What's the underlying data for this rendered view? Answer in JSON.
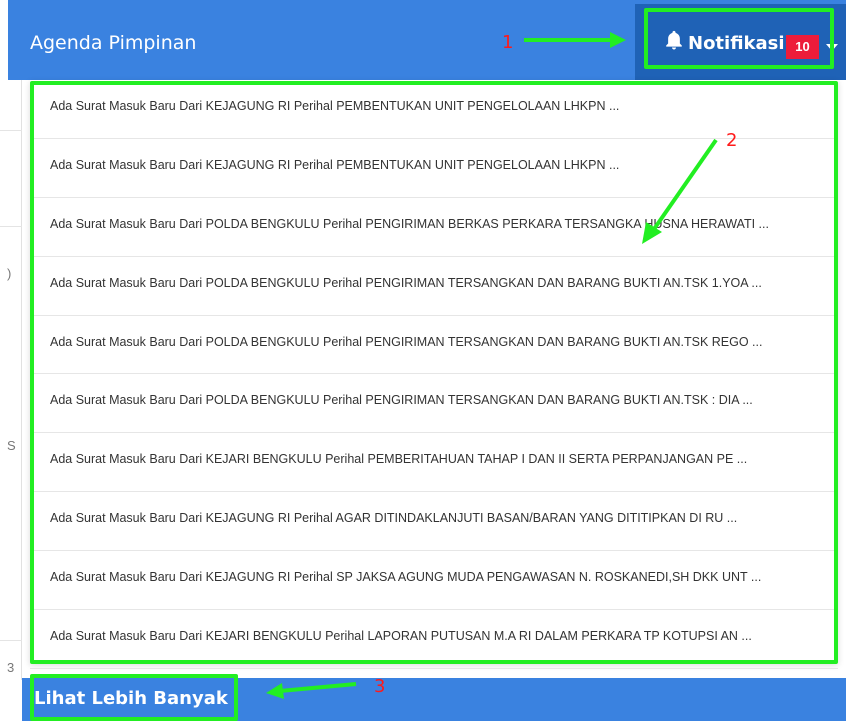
{
  "header": {
    "title": "Agenda Pimpinan",
    "notifications": {
      "icon": "bell-icon",
      "label": "Notifikasi",
      "count": "10",
      "dropdown_icon": "caret-down-icon"
    }
  },
  "notifications": [
    "Ada Surat Masuk Baru Dari KEJAGUNG RI Perihal PEMBENTUKAN UNIT PENGELOLAAN LHKPN ...",
    "Ada Surat Masuk Baru Dari KEJAGUNG RI Perihal PEMBENTUKAN UNIT PENGELOLAAN LHKPN ...",
    "Ada Surat Masuk Baru Dari POLDA BENGKULU Perihal PENGIRIMAN BERKAS PERKARA TERSANGKA HUSNA HERAWATI ...",
    "Ada Surat Masuk Baru Dari POLDA BENGKULU Perihal PENGIRIMAN TERSANGKAN DAN BARANG BUKTI AN.TSK 1.YOA ...",
    "Ada Surat Masuk Baru Dari POLDA BENGKULU Perihal PENGIRIMAN TERSANGKAN DAN BARANG BUKTI AN.TSK REGO ...",
    "Ada Surat Masuk Baru Dari POLDA BENGKULU Perihal PENGIRIMAN TERSANGKAN DAN BARANG BUKTI AN.TSK : DIA ...",
    "Ada Surat Masuk Baru Dari KEJARI BENGKULU Perihal PEMBERITAHUAN TAHAP I DAN II SERTA PERPANJANGAN PE ...",
    "Ada Surat Masuk Baru Dari KEJAGUNG RI Perihal AGAR DITINDAKLANJUTI BASAN/BARAN YANG DITITIPKAN DI RU ...",
    "Ada Surat Masuk Baru Dari KEJAGUNG RI Perihal SP JAKSA AGUNG MUDA PENGAWASAN N. ROSKANEDI,SH DKK UNT ...",
    "Ada Surat Masuk Baru Dari KEJARI BENGKULU Perihal LAPORAN PUTUSAN M.A RI DALAM PERKARA TP KOTUPSI AN ..."
  ],
  "footer": {
    "more_label": "Lihat Lebih Banyak"
  },
  "left_strip_chars": [
    ")",
    "S",
    "3"
  ],
  "annotations": [
    {
      "number": "1"
    },
    {
      "number": "2"
    },
    {
      "number": "3"
    }
  ],
  "colors": {
    "header_bg": "#3a82e0",
    "notif_button_bg": "#1f62b6",
    "badge_bg": "#ed1c3a",
    "highlight": "#22ee22",
    "annotation_number": "#ff1a1a"
  }
}
